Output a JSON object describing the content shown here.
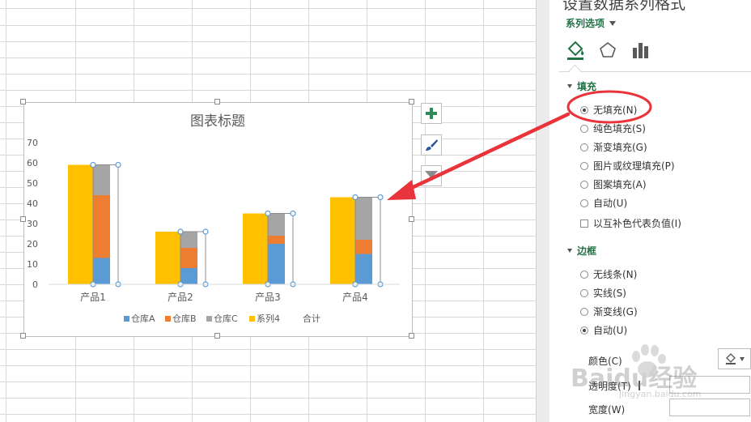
{
  "pane": {
    "title": "设置数据系列格式",
    "series_options": "系列选项",
    "fill_section": "填充",
    "fill_options": [
      {
        "label": "无填充(N)",
        "selected": true
      },
      {
        "label": "纯色填充(S)",
        "selected": false
      },
      {
        "label": "渐变填充(G)",
        "selected": false
      },
      {
        "label": "图片或纹理填充(P)",
        "selected": false
      },
      {
        "label": "图案填充(A)",
        "selected": false
      },
      {
        "label": "自动(U)",
        "selected": false
      }
    ],
    "invert_label": "以互补色代表负值(I)",
    "border_section": "边框",
    "border_options": [
      {
        "label": "无线条(N)",
        "selected": false
      },
      {
        "label": "实线(S)",
        "selected": false
      },
      {
        "label": "渐变线(G)",
        "selected": false
      },
      {
        "label": "自动(U)",
        "selected": true
      }
    ],
    "color_label": "颜色(C)",
    "transparency_label": "透明度(T)",
    "width_label": "宽度(W)"
  },
  "chart_data": {
    "type": "bar",
    "title": "图表标题",
    "categories": [
      "产品1",
      "产品2",
      "产品3",
      "产品4"
    ],
    "ylim": [
      0,
      70
    ],
    "yticks": [
      0,
      10,
      20,
      30,
      40,
      50,
      60,
      70
    ],
    "stacked_series": [
      {
        "name": "仓库A",
        "color": "#5b9bd5",
        "values": [
          13,
          8,
          20,
          15
        ]
      },
      {
        "name": "仓库B",
        "color": "#ed7d31",
        "values": [
          31,
          10,
          4,
          7
        ]
      },
      {
        "name": "仓库C",
        "color": "#a5a5a5",
        "values": [
          15,
          8,
          11,
          21
        ]
      }
    ],
    "side_series": {
      "name": "系列4",
      "color": "#ffc000",
      "values": [
        59,
        26,
        35,
        43
      ]
    },
    "total_series": {
      "name": "合计",
      "values": [
        59,
        26,
        35,
        43
      ]
    },
    "legend": [
      "仓库A",
      "仓库B",
      "仓库C",
      "系列4",
      "合计"
    ],
    "legend_position": "bottom",
    "grid": false
  },
  "annotation": {
    "highlight_color": "#e8343a",
    "arrow_color": "#e8343a"
  },
  "watermark": {
    "text": "Baidu经验",
    "sub": "jingyan.baidu.com"
  }
}
